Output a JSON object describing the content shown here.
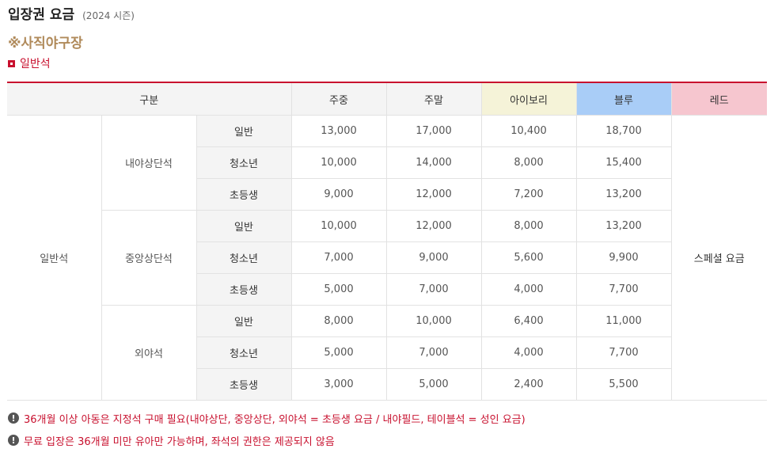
{
  "header": {
    "title": "입장권 요금",
    "season": "(2024 시즌)"
  },
  "venue": "※사직야구장",
  "section_label": "일반석",
  "table": {
    "col_headers": {
      "category": "구분",
      "weekday": "주중",
      "weekend": "주말",
      "ivory": "아이보리",
      "blue": "블루",
      "red": "레드"
    },
    "header_colors": {
      "ivory": "#f5f3d8",
      "blue": "#a9cdf7",
      "red": "#f6c6cf"
    },
    "seat_type": "일반석",
    "red_value": "스페셜 요금",
    "groups": [
      {
        "zone": "내야상단석",
        "rows": [
          {
            "type": "일반",
            "weekday": "13,000",
            "weekend": "17,000",
            "ivory": "10,400",
            "blue": "18,700"
          },
          {
            "type": "청소년",
            "weekday": "10,000",
            "weekend": "14,000",
            "ivory": "8,000",
            "blue": "15,400"
          },
          {
            "type": "초등생",
            "weekday": "9,000",
            "weekend": "12,000",
            "ivory": "7,200",
            "blue": "13,200"
          }
        ]
      },
      {
        "zone": "중앙상단석",
        "rows": [
          {
            "type": "일반",
            "weekday": "10,000",
            "weekend": "12,000",
            "ivory": "8,000",
            "blue": "13,200"
          },
          {
            "type": "청소년",
            "weekday": "7,000",
            "weekend": "9,000",
            "ivory": "5,600",
            "blue": "9,900"
          },
          {
            "type": "초등생",
            "weekday": "5,000",
            "weekend": "7,000",
            "ivory": "4,000",
            "blue": "7,700"
          }
        ]
      },
      {
        "zone": "외야석",
        "rows": [
          {
            "type": "일반",
            "weekday": "8,000",
            "weekend": "10,000",
            "ivory": "6,400",
            "blue": "11,000"
          },
          {
            "type": "청소년",
            "weekday": "5,000",
            "weekend": "7,000",
            "ivory": "4,000",
            "blue": "7,700"
          },
          {
            "type": "초등생",
            "weekday": "3,000",
            "weekend": "5,000",
            "ivory": "2,400",
            "blue": "5,500"
          }
        ]
      }
    ]
  },
  "notes": [
    "36개월 이상 아동은 지정석 구매 필요(내야상단, 중앙상단, 외야석 = 초등생 요금 / 내야필드, 테이블석 = 성인 요금)",
    "무료 입장은 36개월 미만 유아만 가능하며, 좌석의 권한은 제공되지 않음"
  ],
  "note_icon_glyph": "!"
}
